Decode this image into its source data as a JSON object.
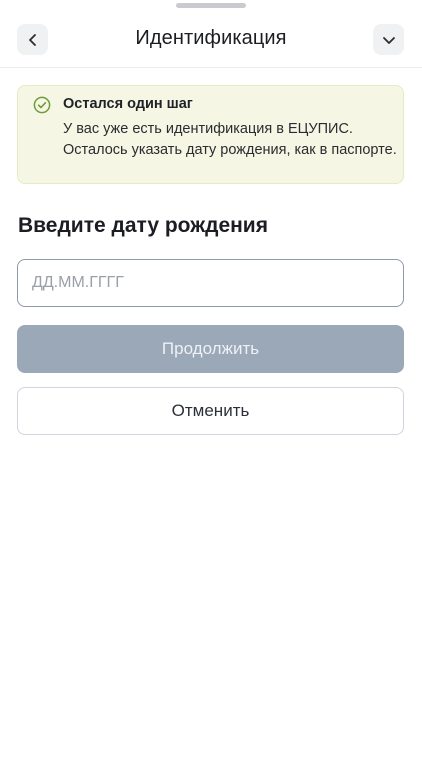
{
  "header": {
    "title": "Идентификация",
    "back_icon": "chevron-left-icon",
    "collapse_icon": "chevron-down-icon"
  },
  "notice": {
    "icon": "check-circle-icon",
    "title": "Остался один шаг",
    "text": "У вас уже есть идентификация в ЕЦУПИС. Осталось указать дату рождения, как в паспорте.",
    "accent_color": "#6f9a3a"
  },
  "form": {
    "heading": "Введите дату рождения",
    "date_placeholder": "ДД.ММ.ГГГГ",
    "date_value": "",
    "continue_label": "Продолжить",
    "cancel_label": "Отменить"
  },
  "colors": {
    "primary_disabled": "#9aa8b8",
    "notice_background": "#f5f7e4"
  }
}
